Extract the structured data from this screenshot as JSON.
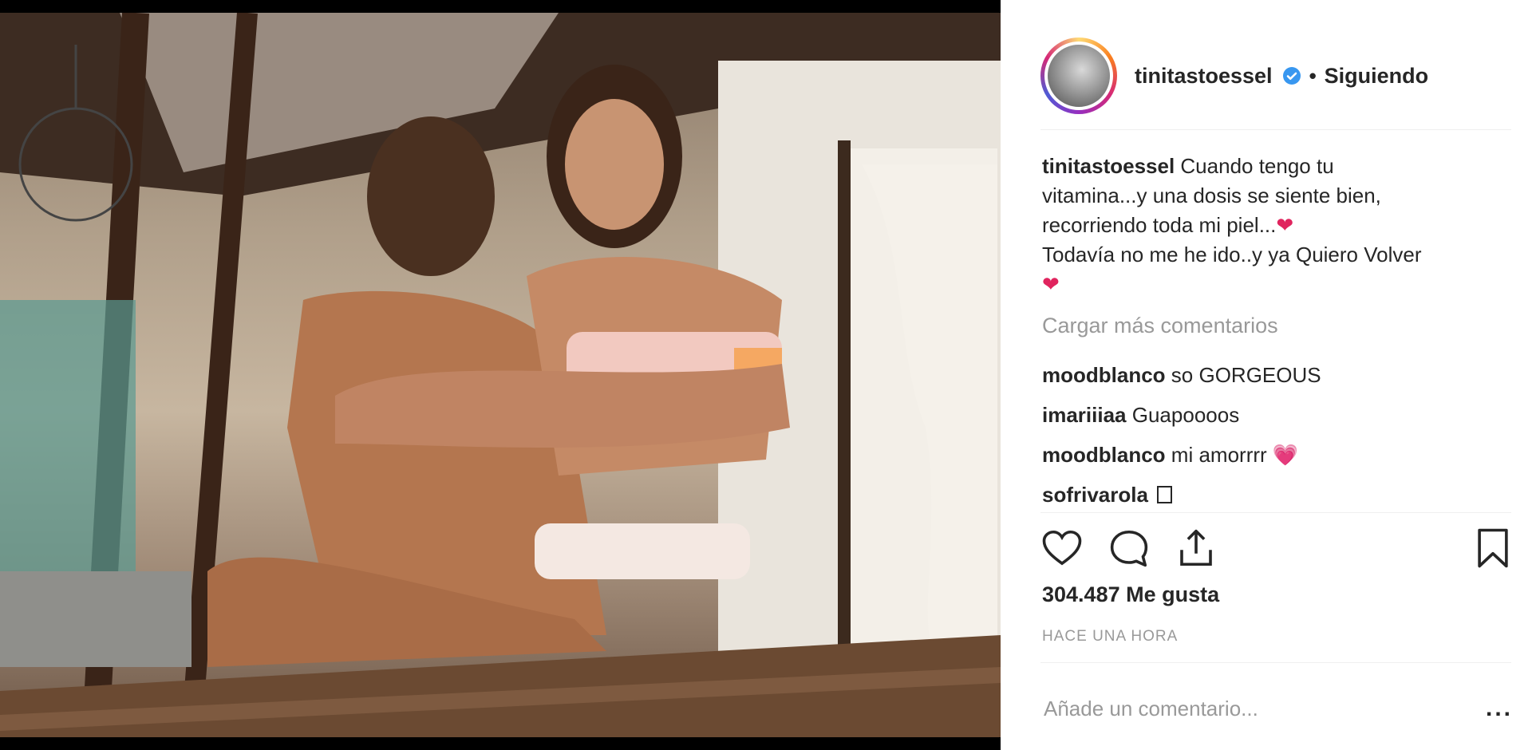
{
  "post": {
    "photo_icon": "photo-couple-image",
    "username": "tinitastoessel",
    "verified_icon": "verified-badge-icon",
    "separator": "•",
    "following_label": "Siguiendo",
    "caption": {
      "username": "tinitastoessel",
      "line1": "Cuando tengo tu",
      "line2": "vitamina...y una dosis se siente bien,",
      "line3": "recorriendo toda mi piel...",
      "line4": "Todavía no me he ido..y ya Quiero Volver",
      "heart": "❤"
    },
    "load_more_label": "Cargar más comentarios",
    "comments": [
      {
        "user": "moodblanco",
        "text": "so GORGEOUS"
      },
      {
        "user": "imariiiaa",
        "text": "Guapoooos"
      },
      {
        "user": "moodblanco",
        "text": "mi amorrrr",
        "emoji": "💗"
      },
      {
        "user": "sofrivarola",
        "text": ""
      }
    ],
    "likes_label": "304.487 Me gusta",
    "time_label": "HACE UNA HORA",
    "comment_placeholder": "Añade un comentario...",
    "more_label": "...",
    "icons": [
      "heart-icon",
      "comment-icon",
      "share-icon",
      "bookmark-icon"
    ]
  }
}
